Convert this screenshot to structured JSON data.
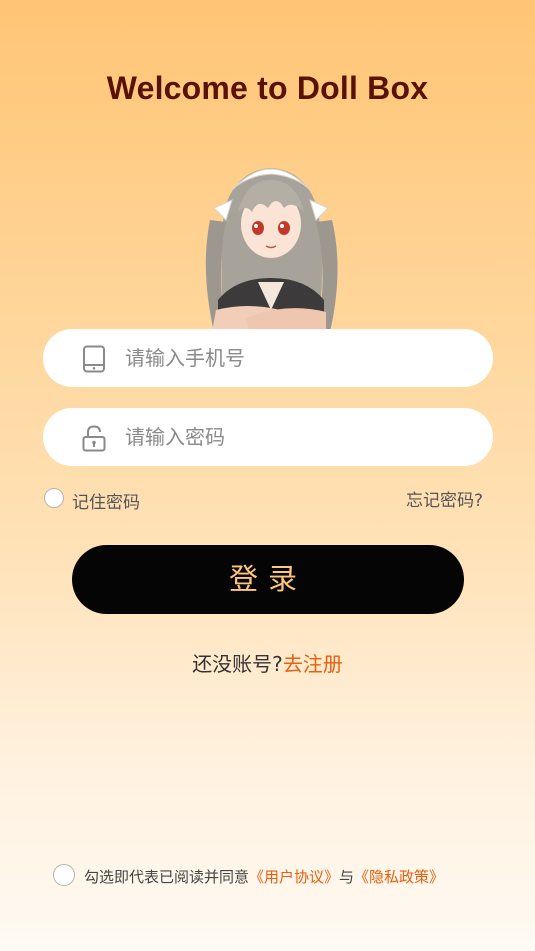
{
  "header": {
    "title": "Welcome to Doll Box"
  },
  "mascot": {
    "icon": "maid-girl-illustration"
  },
  "form": {
    "phone": {
      "placeholder": "请输入手机号",
      "value": "",
      "icon": "phone-icon"
    },
    "password": {
      "placeholder": "请输入密码",
      "value": "",
      "icon": "unlock-icon"
    },
    "remember_label": "记住密码",
    "remember_checked": false,
    "forgot_label": "忘记密码?"
  },
  "login": {
    "label": "登录"
  },
  "register": {
    "prompt": "还没账号?",
    "link": "去注册"
  },
  "agreement": {
    "checked": false,
    "text": "勾选即代表已阅读并同意",
    "user_agreement": "《用户协议》",
    "joiner": "与",
    "privacy_policy": "《隐私政策》"
  },
  "colors": {
    "accent": "#ea5e0f",
    "button_bg": "#050505",
    "button_text": "#ffc57a",
    "title": "#5a1208"
  }
}
